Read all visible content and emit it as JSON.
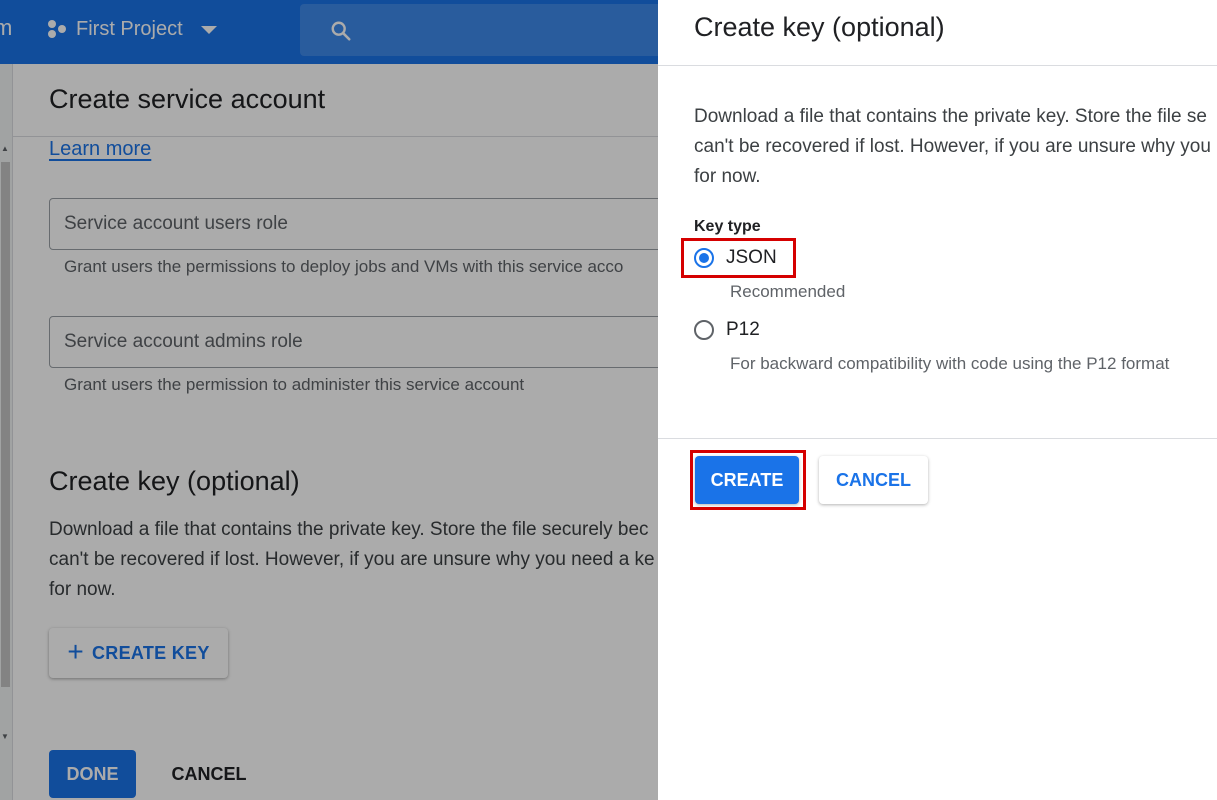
{
  "colors": {
    "accent": "#1a73e8",
    "highlight": "#d50000",
    "scrim": "rgba(0,0,0,0.33)"
  },
  "topbar": {
    "app_fragment": "m",
    "project_name": "First Project",
    "project_icon": "project-hub-icon",
    "search_icon": "search-icon"
  },
  "page": {
    "title": "Create service account",
    "learn_more": "Learn more",
    "fields": [
      {
        "label": "Service account users role",
        "helper": "Grant users the permissions to deploy jobs and VMs with this service acco"
      },
      {
        "label": "Service account admins role",
        "helper": "Grant users the permission to administer this service account"
      }
    ],
    "create_key_section": {
      "title": "Create key (optional)",
      "body_lines": [
        "Download a file that contains the private key. Store the file securely bec",
        "can't be recovered if lost. However, if you are unsure why you need a ke",
        "for now."
      ],
      "create_key_button": "CREATE KEY"
    },
    "done_button": "DONE",
    "cancel_button": "CANCEL"
  },
  "panel": {
    "title": "Create key (optional)",
    "description_lines": [
      "Download a file that contains the private key. Store the file se",
      "can't be recovered if lost. However, if you are unsure why you",
      "for now."
    ],
    "key_type_label": "Key type",
    "options": [
      {
        "label": "JSON",
        "sublabel": "Recommended",
        "selected": true
      },
      {
        "label": "P12",
        "sublabel": "For backward compatibility with code using the P12 format",
        "selected": false
      }
    ],
    "create_button": "CREATE",
    "cancel_button": "CANCEL"
  }
}
